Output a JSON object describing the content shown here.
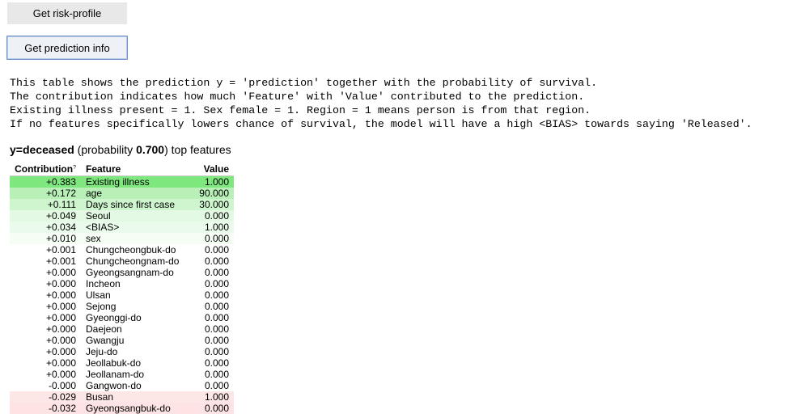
{
  "buttons": {
    "risk_profile": "Get risk-profile",
    "prediction_info": "Get prediction info"
  },
  "description": [
    "This table shows the prediction y = 'prediction' together with the probability of survival.",
    "The contribution indicates how much 'Feature' with 'Value' contributed to the prediction.",
    "Existing illness present = 1. Sex female = 1. Region = 1 means person is from that region.",
    "If no features specifically lowers chance of survival, the model will have a high <BIAS> towards saying 'Released'."
  ],
  "heading": {
    "target": "y=deceased",
    "prob_prefix": " (probability ",
    "probability": "0.700",
    "suffix": ") top features"
  },
  "table": {
    "headers": {
      "contribution": "Contribution",
      "contribution_sup": "?",
      "feature": "Feature",
      "value": "Value"
    },
    "rows": [
      {
        "contribution": "+0.383",
        "feature": "Existing illness",
        "value": "1.000",
        "color": "#7ee87e"
      },
      {
        "contribution": "+0.172",
        "feature": "age",
        "value": "90.000",
        "color": "#b8f0b8"
      },
      {
        "contribution": "+0.111",
        "feature": "Days since first case",
        "value": "30.000",
        "color": "#cef5ce"
      },
      {
        "contribution": "+0.049",
        "feature": "Seoul",
        "value": "0.000",
        "color": "#e4f9e4"
      },
      {
        "contribution": "+0.034",
        "feature": "<BIAS>",
        "value": "1.000",
        "color": "#ebfbeb"
      },
      {
        "contribution": "+0.010",
        "feature": "sex",
        "value": "0.000",
        "color": "#f5fdf5"
      },
      {
        "contribution": "+0.001",
        "feature": "Chungcheongbuk-do",
        "value": "0.000",
        "color": "#ffffff"
      },
      {
        "contribution": "+0.001",
        "feature": "Chungcheongnam-do",
        "value": "0.000",
        "color": "#ffffff"
      },
      {
        "contribution": "+0.000",
        "feature": "Gyeongsangnam-do",
        "value": "0.000",
        "color": "#ffffff"
      },
      {
        "contribution": "+0.000",
        "feature": "Incheon",
        "value": "0.000",
        "color": "#ffffff"
      },
      {
        "contribution": "+0.000",
        "feature": "Ulsan",
        "value": "0.000",
        "color": "#ffffff"
      },
      {
        "contribution": "+0.000",
        "feature": "Sejong",
        "value": "0.000",
        "color": "#ffffff"
      },
      {
        "contribution": "+0.000",
        "feature": "Gyeonggi-do",
        "value": "0.000",
        "color": "#ffffff"
      },
      {
        "contribution": "+0.000",
        "feature": "Daejeon",
        "value": "0.000",
        "color": "#ffffff"
      },
      {
        "contribution": "+0.000",
        "feature": "Gwangju",
        "value": "0.000",
        "color": "#ffffff"
      },
      {
        "contribution": "+0.000",
        "feature": "Jeju-do",
        "value": "0.000",
        "color": "#ffffff"
      },
      {
        "contribution": "+0.000",
        "feature": "Jeollabuk-do",
        "value": "0.000",
        "color": "#ffffff"
      },
      {
        "contribution": "+0.000",
        "feature": "Jeollanam-do",
        "value": "0.000",
        "color": "#ffffff"
      },
      {
        "contribution": "-0.000",
        "feature": "Gangwon-do",
        "value": "0.000",
        "color": "#ffffff"
      },
      {
        "contribution": "-0.029",
        "feature": "Busan",
        "value": "1.000",
        "color": "#fde6e6"
      },
      {
        "contribution": "-0.032",
        "feature": "Gyeongsangbuk-do",
        "value": "0.000",
        "color": "#fde3e3"
      }
    ]
  }
}
